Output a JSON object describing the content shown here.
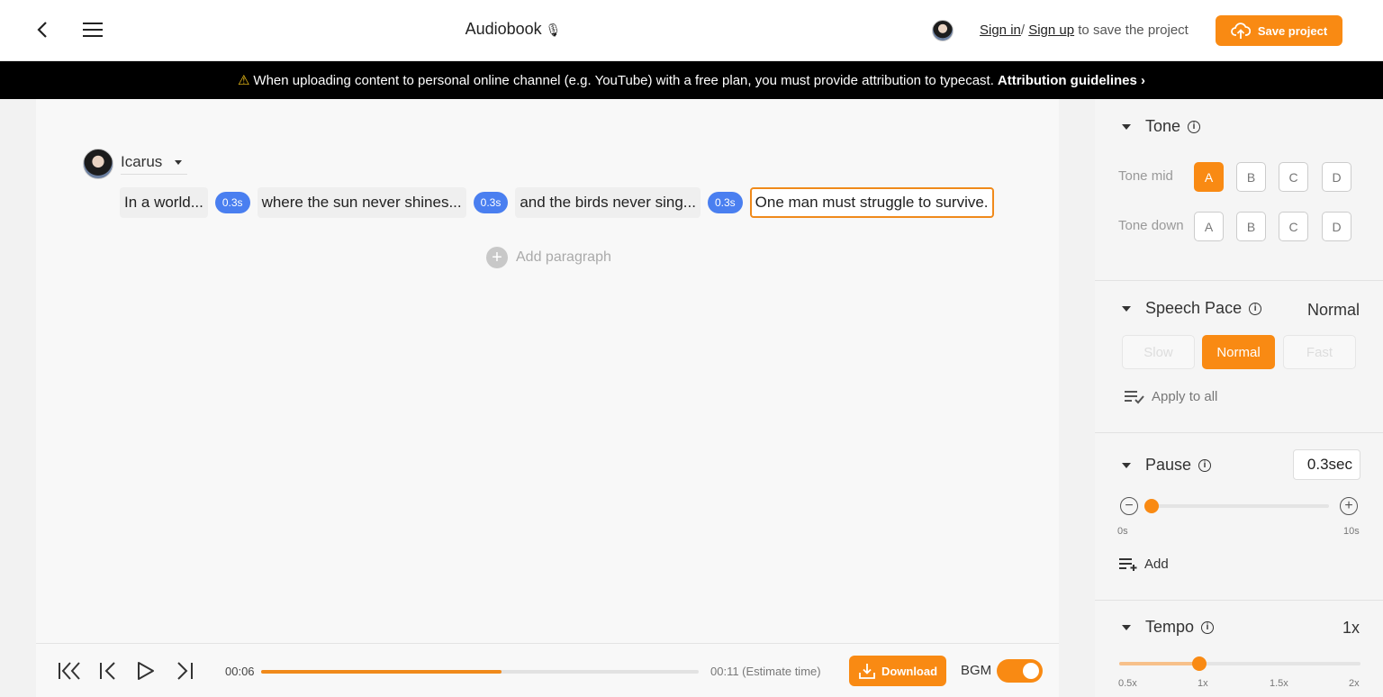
{
  "header": {
    "title": "Audiobook",
    "title_icon": "🎙",
    "sign_in": "Sign in",
    "separator": "/",
    "sign_up": "Sign up",
    "auth_suffix": "to save the project",
    "save_label": "Save project"
  },
  "banner": {
    "icon": "⚠",
    "text": "When uploading content to personal online channel (e.g. YouTube) with a free plan, you must provide attribution to typecast.",
    "link": "Attribution guidelines",
    "link_arrow": "›"
  },
  "editor": {
    "speaker": "Icarus",
    "sentences": [
      "In a world...",
      "where the sun never shines...",
      "and the birds never sing...",
      "One man must struggle to survive."
    ],
    "pauses": [
      "0.3s",
      "0.3s",
      "0.3s"
    ],
    "add_paragraph": "Add paragraph"
  },
  "player": {
    "current_time": "00:06",
    "total_time": "00:11 (Estimate time)",
    "progress": 0.55,
    "download_label": "Download",
    "bgm_label": "BGM",
    "bgm_on": true
  },
  "panel": {
    "tone": {
      "title": "Tone",
      "mid_label": "Tone mid",
      "down_label": "Tone down",
      "options": [
        "A",
        "B",
        "C",
        "D"
      ],
      "mid_selected": "A"
    },
    "speech_pace": {
      "title": "Speech Pace",
      "value": "Normal",
      "options": [
        "Slow",
        "Normal",
        "Fast"
      ],
      "apply_all": "Apply to all"
    },
    "pause": {
      "title": "Pause",
      "value": "0.3sec",
      "min_label": "0s",
      "max_label": "10s",
      "level": 0.03,
      "add_label": "Add"
    },
    "tempo": {
      "title": "Tempo",
      "value": "1x",
      "ticks": [
        "0.5x",
        "1x",
        "1.5x",
        "2x"
      ],
      "level": 0.333
    }
  },
  "colors": {
    "accent": "#f98a13",
    "pause_chip": "#4a7ff0",
    "banner_bg": "#000000"
  }
}
